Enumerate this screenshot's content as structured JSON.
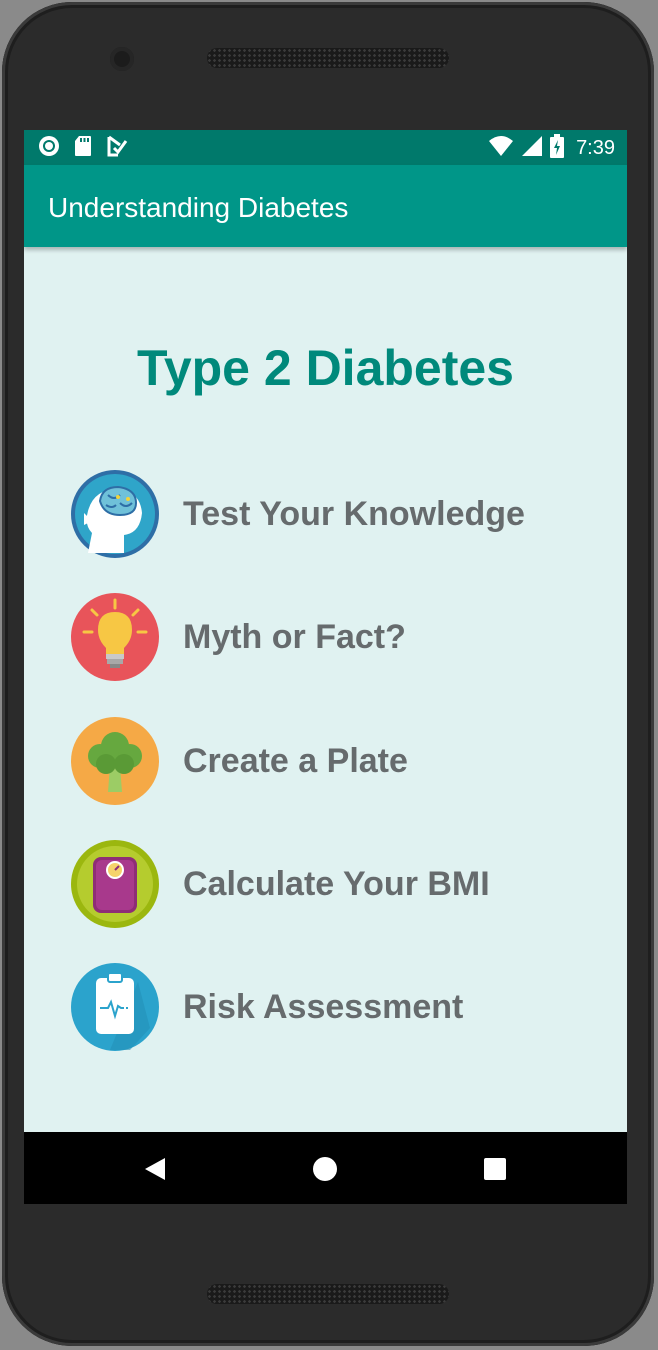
{
  "status_bar": {
    "time": "7:39",
    "icons": [
      "record-icon",
      "sd-card-icon",
      "download-check-icon",
      "wifi-icon",
      "signal-icon",
      "battery-charging-icon"
    ]
  },
  "app_bar": {
    "title": "Understanding Diabetes"
  },
  "main": {
    "heading": "Type 2 Diabetes",
    "menu": [
      {
        "label": "Test Your Knowledge",
        "icon": "brain-head-icon",
        "color": "#2e6ea6"
      },
      {
        "label": "Myth or Fact?",
        "icon": "lightbulb-icon",
        "color": "#e8545a"
      },
      {
        "label": "Create a Plate",
        "icon": "broccoli-icon",
        "color": "#f5a946"
      },
      {
        "label": "Calculate Your BMI",
        "icon": "bathroom-scale-icon",
        "color": "#9bb70f"
      },
      {
        "label": "Risk Assessment",
        "icon": "clipboard-heartbeat-icon",
        "color": "#2ba3cc"
      }
    ]
  },
  "nav_bar": {
    "buttons": [
      "back-icon",
      "home-icon",
      "recents-icon"
    ]
  },
  "colors": {
    "status_bar": "#00796b",
    "app_bar": "#009688",
    "background": "#e0f2f1",
    "heading": "#00897b",
    "menu_text": "#666b6d"
  }
}
